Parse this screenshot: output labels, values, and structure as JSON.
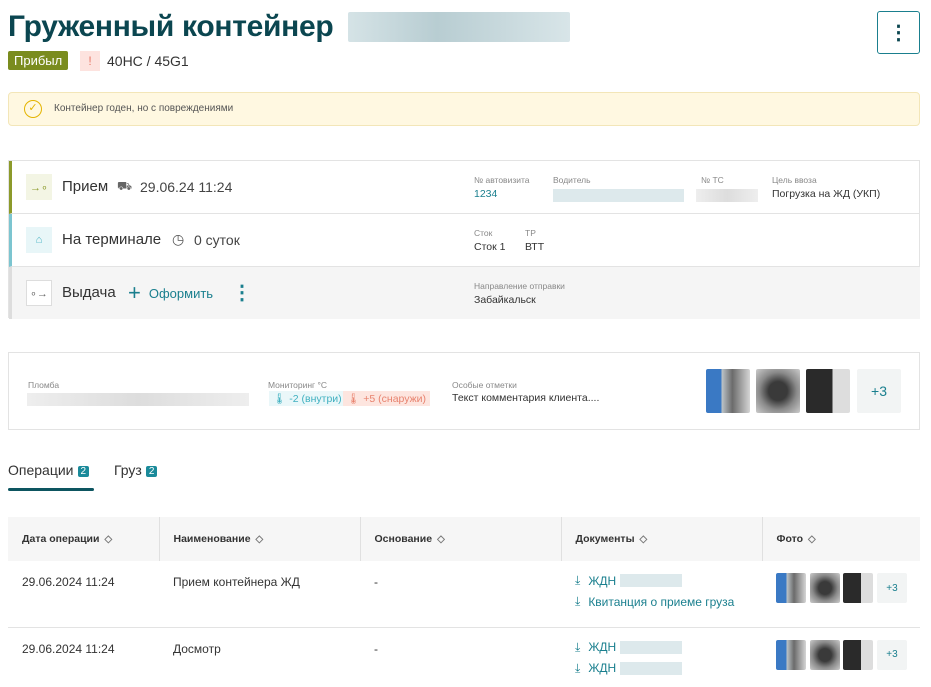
{
  "header": {
    "title": "Груженный контейнер",
    "status": "Прибыл",
    "type": "40HC / 45G1",
    "menu_icon": "more-vertical-icon"
  },
  "alert": {
    "text": "Контейнер годен, но с повреждениями"
  },
  "stages": [
    {
      "name": "Прием",
      "datetime": "29.06.24 11:24",
      "fields": [
        {
          "label": "№ автовизита",
          "value": "1234"
        },
        {
          "label": "Водитель"
        },
        {
          "label": "№ ТС"
        },
        {
          "label": "Цель ввоза",
          "value": "Погрузка на ЖД (УКП)"
        }
      ]
    },
    {
      "name": "На терминале",
      "duration": "0 суток",
      "fields": [
        {
          "label": "Сток",
          "value": "Сток 1"
        },
        {
          "label": "ТР",
          "value": "ВТТ"
        }
      ]
    },
    {
      "name": "Выдача",
      "action": "Оформить",
      "fields": [
        {
          "label": "Направление отправки",
          "value": "Забайкальск"
        }
      ]
    }
  ],
  "info": {
    "seal_label": "Пломба",
    "monitoring_label": "Мониторинг °C",
    "temp_inside": "-2 (внутри)",
    "temp_outside": "+5 (снаружи)",
    "notes_label": "Особые отметки",
    "notes": "Текст комментария клиента....",
    "photos_more": "+3"
  },
  "tabs": [
    {
      "label": "Операции",
      "count": "2"
    },
    {
      "label": "Груз",
      "count": "2"
    }
  ],
  "table": {
    "columns": [
      "Дата операции",
      "Наименование",
      "Основание",
      "Документы",
      "Фото"
    ],
    "rows": [
      {
        "date": "29.06.2024 11:24",
        "name": "Прием контейнера ЖД",
        "basis": "-",
        "docs": [
          "ЖДН",
          "Квитанция о приеме груза"
        ],
        "more": "+3"
      },
      {
        "date": "29.06.2024 11:24",
        "name": "Досмотр",
        "basis": "-",
        "docs": [
          "ЖДН",
          "ЖДН"
        ],
        "more": "+3"
      }
    ]
  },
  "colors": {
    "accent": "#1a7f8e",
    "title": "#0b4650",
    "status": "#7a8c1e"
  }
}
